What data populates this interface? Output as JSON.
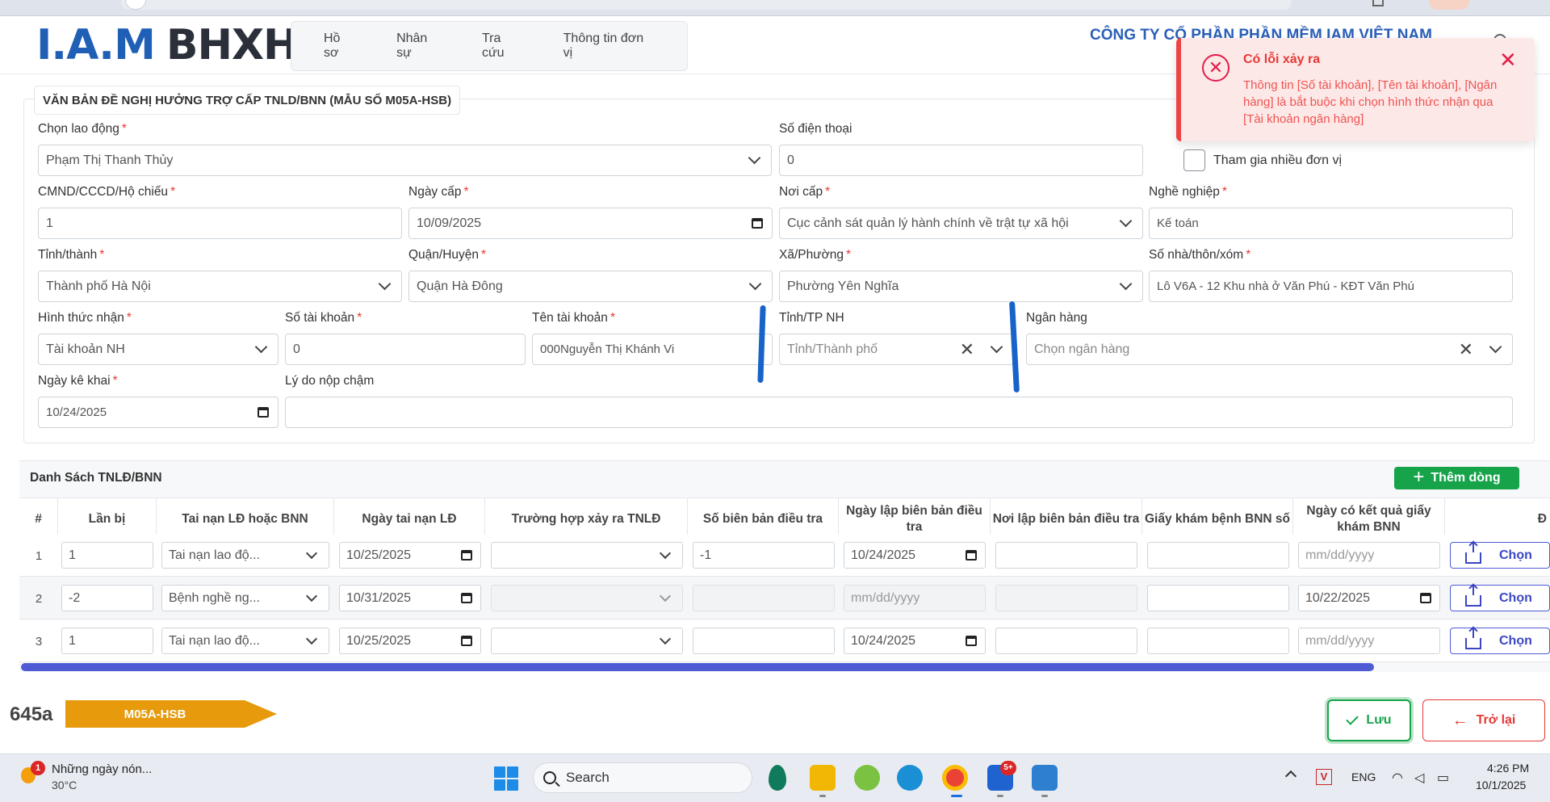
{
  "header": {
    "logo_part1": "I.A.M",
    "logo_part2": "BHXH",
    "nav": [
      "Hồ sơ",
      "Nhân sự",
      "Tra cứu",
      "Thông tin đơn vị"
    ],
    "company": "CÔNG TY CỔ PHẦN PHẦN MỀM IAM VIỆT NAM"
  },
  "toast": {
    "title": "Có lỗi xảy ra",
    "message": "Thông tin [Số tài khoản], [Tên tài khoản], [Ngân hàng] là bắt buộc khi chọn hình thức nhận qua [Tài khoản ngân hàng]",
    "close": "✕",
    "icon": "x-circle-icon"
  },
  "form": {
    "legend": "VĂN BẢN ĐỀ NGHỊ HƯỞNG TRỢ CẤP TNLD/BNN (MẪU SỐ M05A-HSB)",
    "required_mark": "*",
    "employee": {
      "label": "Chọn lao động",
      "value": "Phạm Thị Thanh Thủy"
    },
    "phone": {
      "label": "Số điện thoại",
      "value": "0"
    },
    "multi_unit": {
      "label": "Tham gia nhiều đơn vị",
      "checked": false
    },
    "id_number": {
      "label": "CMND/CCCD/Hộ chiếu",
      "value": "1"
    },
    "issue_date": {
      "label": "Ngày cấp",
      "value": "10/09/2025"
    },
    "issue_place": {
      "label": "Nơi cấp",
      "value": "Cục cảnh sát quản lý hành chính về trật tự xã hội"
    },
    "occupation": {
      "label": "Nghề nghiệp",
      "value": "Kế toán"
    },
    "province": {
      "label": "Tỉnh/thành",
      "value": "Thành phố Hà Nội"
    },
    "district": {
      "label": "Quận/Huyện",
      "value": "Quận Hà Đông"
    },
    "ward": {
      "label": "Xã/Phường",
      "value": "Phường Yên Nghĩa"
    },
    "address": {
      "label": "Số nhà/thôn/xóm",
      "value": "Lô V6A - 12 Khu nhà ở Văn Phú - KĐT Văn Phú"
    },
    "receive_method": {
      "label": "Hình thức nhận",
      "value": "Tài khoản NH"
    },
    "account_number": {
      "label": "Số tài khoản",
      "value": "0"
    },
    "account_name": {
      "label": "Tên tài khoản",
      "value": "000Nguyễn Thị Khánh Vi"
    },
    "bank_province": {
      "label": "Tỉnh/TP NH",
      "placeholder": "Tỉnh/Thành phố",
      "clear": "✕"
    },
    "bank": {
      "label": "Ngân hàng",
      "placeholder": "Chọn ngân hàng",
      "clear": "✕"
    },
    "declare_date": {
      "label": "Ngày kê khai",
      "value": "10/24/2025"
    },
    "late_reason": {
      "label": "Lý do nộp chậm",
      "value": ""
    }
  },
  "list": {
    "title": "Danh Sách TNLĐ/BNN",
    "add_button": "Thêm dòng",
    "add_icon": "+",
    "columns": [
      "#",
      "Lần bị",
      "Tai nạn LĐ hoặc BNN",
      "Ngày tai nạn LĐ",
      "Trường hợp xảy ra TNLĐ",
      "Số biên bản điều tra",
      "Ngày lập biên bản điều tra",
      "Nơi lập biên bản điều tra",
      "Giấy khám bệnh BNN số",
      "Ngày có kết quả giấy khám BNN",
      "Đ"
    ],
    "rows": [
      {
        "num": "1",
        "times": "1",
        "type": "Tai nạn lao độ...",
        "accident_date": "10/25/2025",
        "case": "",
        "report_no": "-1",
        "report_date": "10/24/2025",
        "report_place": "",
        "exam_no": "",
        "exam_date": "mm/dd/yyyy",
        "upload": "Chọn"
      },
      {
        "num": "2",
        "times": "-2",
        "type": "Bệnh nghề ng...",
        "accident_date": "10/31/2025",
        "case": "",
        "report_no": "",
        "report_date": "mm/dd/yyyy",
        "report_place": "",
        "exam_no": "",
        "exam_date": "10/22/2025",
        "upload": "Chọn"
      },
      {
        "num": "3",
        "times": "1",
        "type": "Tai nạn lao độ...",
        "accident_date": "10/25/2025",
        "case": "",
        "report_no": "",
        "report_date": "10/24/2025",
        "report_place": "",
        "exam_no": "",
        "exam_date": "mm/dd/yyyy",
        "upload": "Chọn"
      }
    ]
  },
  "footer": {
    "form_code": "645a",
    "tag": "M05A-HSB",
    "save": "Lưu",
    "back": "Trở lại",
    "back_icon": "←"
  },
  "taskbar": {
    "weather_title": "Những ngày nón...",
    "weather_temp": "30°C",
    "weather_badge": "1",
    "search": "Search",
    "zalo_badge": "5+",
    "tray_v": "V",
    "lang": "ENG",
    "time": "4:26 PM",
    "date": "10/1/2025"
  },
  "colors": {
    "brand_blue": "#1f5fb5",
    "error_red": "#ef4444",
    "success_green": "#16a34a",
    "accent_indigo": "#4f5bd5",
    "tag_orange": "#e69a0c"
  }
}
